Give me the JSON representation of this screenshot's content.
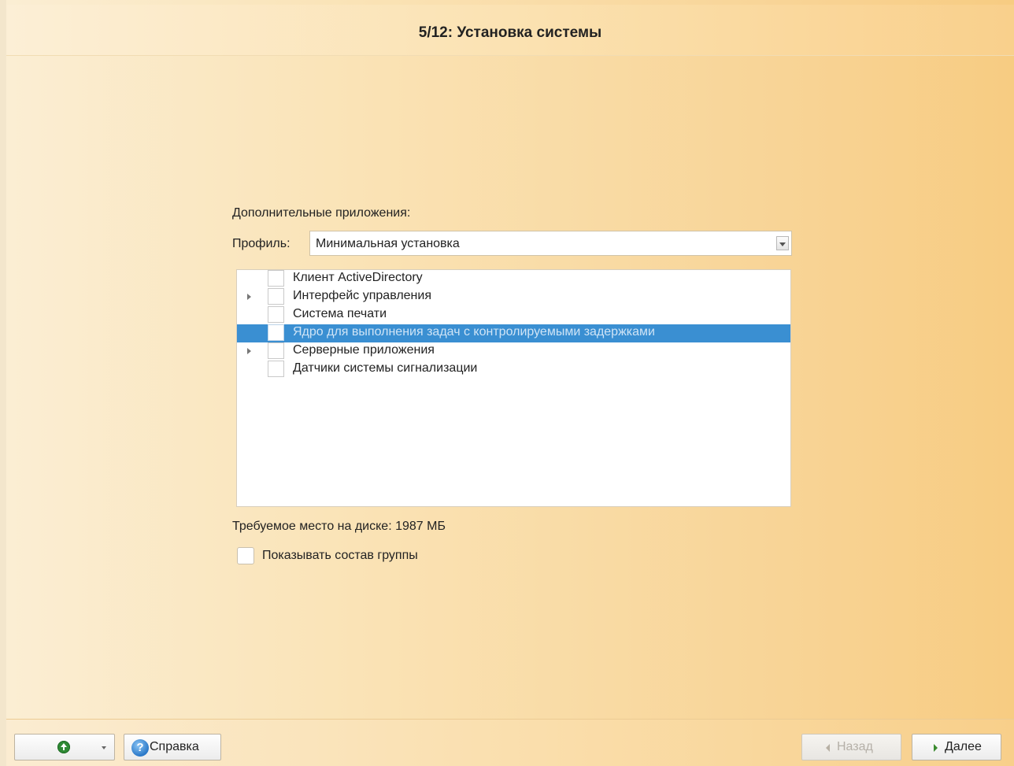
{
  "header": {
    "title": "5/12: Установка системы"
  },
  "main": {
    "section_label": "Дополнительные приложения:",
    "profile": {
      "label": "Профиль:",
      "value": "Минимальная установка"
    },
    "tree": [
      {
        "label": "Клиент ActiveDirectory",
        "expandable": false,
        "checked": false,
        "selected": false
      },
      {
        "label": "Интерфейс управления",
        "expandable": true,
        "checked": false,
        "selected": false
      },
      {
        "label": "Система печати",
        "expandable": false,
        "checked": false,
        "selected": false
      },
      {
        "label": "Ядро для выполнения задач с контролируемыми задержками",
        "expandable": false,
        "checked": false,
        "selected": true
      },
      {
        "label": "Серверные приложения",
        "expandable": true,
        "checked": false,
        "selected": false
      },
      {
        "label": "Датчики системы сигнализации",
        "expandable": false,
        "checked": false,
        "selected": false
      }
    ],
    "disk_space": "Требуемое место на диске: 1987 МБ",
    "show_group": {
      "label": "Показывать состав группы",
      "checked": false
    }
  },
  "footer": {
    "help_label": "Справка",
    "back_label": "Назад",
    "next_label": "Далее",
    "back_enabled": false
  },
  "icons": {
    "up": "up-arrow-icon",
    "help": "help-icon",
    "back": "back-arrow-icon",
    "next": "next-arrow-icon"
  },
  "colors": {
    "selection": "#3a8fd2",
    "background_light": "#fbeed4",
    "background_dark": "#f7cc82"
  }
}
